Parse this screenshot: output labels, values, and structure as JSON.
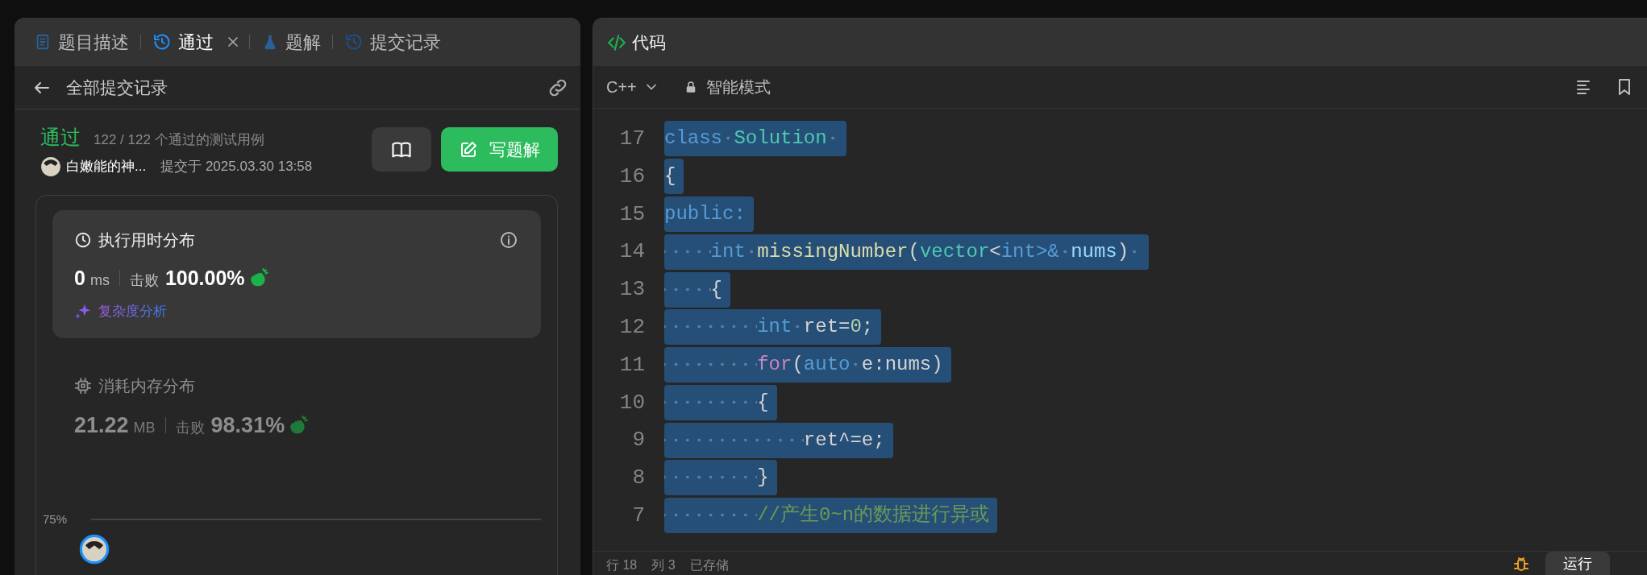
{
  "tabs": [
    {
      "label": "题目描述",
      "kind": "doc",
      "selected": false,
      "closable": false
    },
    {
      "label": "通过",
      "kind": "history",
      "selected": true,
      "closable": true
    },
    {
      "label": "题解",
      "kind": "flask",
      "selected": false,
      "closable": false
    },
    {
      "label": "提交记录",
      "kind": "history",
      "selected": false,
      "closable": false
    }
  ],
  "subheader": {
    "title": "全部提交记录"
  },
  "submission": {
    "status": "通过",
    "testcases": "122 / 122 个通过的测试用例",
    "author": "白嫩能的神...",
    "submitted": "提交于 2025.03.30 13:58",
    "write_button": "写题解"
  },
  "runtime": {
    "title": "执行用时分布",
    "value": "0",
    "unit": "ms",
    "beats_label": "击败",
    "beats": "100.00%",
    "analysis_link": "复杂度分析",
    "selected": true
  },
  "memory": {
    "title": "消耗内存分布",
    "value": "21.22",
    "unit": "MB",
    "beats_label": "击败",
    "beats": "98.31%",
    "selected": false
  },
  "chart": {
    "tick_label": "75%"
  },
  "editor": {
    "title": "代码",
    "language": "C++",
    "mode": "智能模式",
    "lines": [
      {
        "number": "17",
        "selected": true,
        "tokens": [
          {
            "kind": "keyword",
            "text": "class "
          },
          {
            "kind": "type",
            "text": "Solution "
          }
        ]
      },
      {
        "number": "16",
        "selected": true,
        "tokens": [
          {
            "kind": "plain",
            "text": "{"
          }
        ]
      },
      {
        "number": "15",
        "selected": true,
        "tokens": [
          {
            "kind": "keyword",
            "text": "public:"
          }
        ]
      },
      {
        "number": "14",
        "selected": true,
        "tokens": [
          {
            "kind": "keyword",
            "text": "    int "
          },
          {
            "kind": "function",
            "text": "missingNumber"
          },
          {
            "kind": "plain",
            "text": "("
          },
          {
            "kind": "type",
            "text": "vector"
          },
          {
            "kind": "plain",
            "text": "<"
          },
          {
            "kind": "keyword",
            "text": "int>& "
          },
          {
            "kind": "variable",
            "text": "nums"
          },
          {
            "kind": "plain",
            "text": ") "
          }
        ]
      },
      {
        "number": "13",
        "selected": true,
        "tokens": [
          {
            "kind": "plain",
            "text": "    {"
          }
        ]
      },
      {
        "number": "12",
        "selected": true,
        "tokens": [
          {
            "kind": "keyword",
            "text": "        int "
          },
          {
            "kind": "plain",
            "text": "ret="
          },
          {
            "kind": "number",
            "text": "0"
          },
          {
            "kind": "plain",
            "text": ";"
          }
        ]
      },
      {
        "number": "11",
        "selected": true,
        "tokens": [
          {
            "kind": "control",
            "text": "        for"
          },
          {
            "kind": "plain",
            "text": "("
          },
          {
            "kind": "keyword",
            "text": "auto "
          },
          {
            "kind": "plain",
            "text": "e:nums)"
          }
        ]
      },
      {
        "number": "10",
        "selected": true,
        "tokens": [
          {
            "kind": "plain",
            "text": "        {"
          }
        ]
      },
      {
        "number": "9",
        "selected": true,
        "tokens": [
          {
            "kind": "plain",
            "text": "            ret^=e;"
          }
        ]
      },
      {
        "number": "8",
        "selected": true,
        "tokens": [
          {
            "kind": "plain",
            "text": "        }"
          }
        ]
      },
      {
        "number": "7",
        "selected": true,
        "tokens": [
          {
            "kind": "comment",
            "text": "        //产生0~n的数据进行异或"
          }
        ]
      }
    ]
  },
  "status_bar": {
    "line": "行 18",
    "column": "列 3",
    "saved": "已存储",
    "run_button": "运行"
  }
}
